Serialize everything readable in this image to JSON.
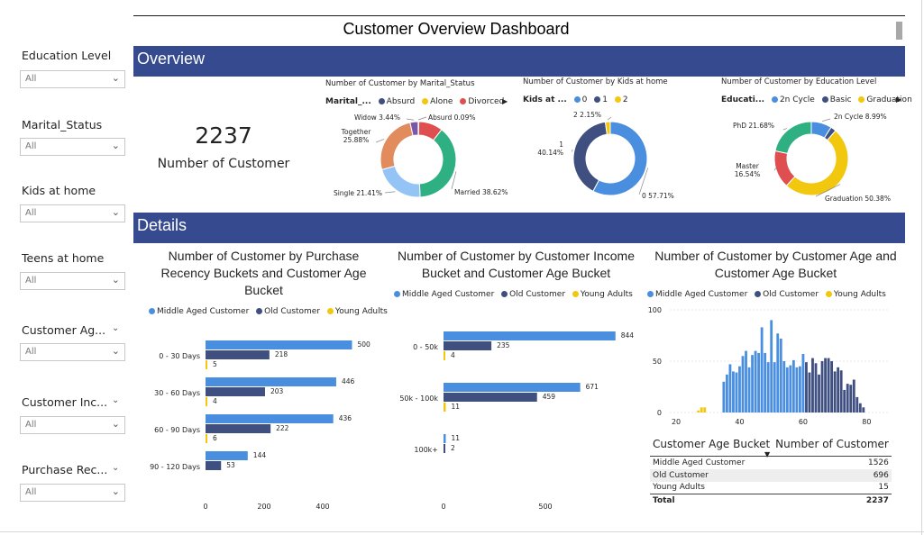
{
  "title": "Customer Overview Dashboard",
  "slicers": [
    {
      "label": "Education Level",
      "value": "All",
      "chevron_on_label": false
    },
    {
      "label": "Marital_Status",
      "value": "All",
      "chevron_on_label": false
    },
    {
      "label": "Kids at home",
      "value": "All",
      "chevron_on_label": false
    },
    {
      "label": "Teens at home",
      "value": "All",
      "chevron_on_label": false
    },
    {
      "label": "Customer Ag...",
      "value": "All",
      "chevron_on_label": true
    },
    {
      "label": "Customer Inc...",
      "value": "All",
      "chevron_on_label": true
    },
    {
      "label": "Purchase Rec...",
      "value": "All",
      "chevron_on_label": true
    }
  ],
  "overview": {
    "banner": "Overview",
    "kpi": {
      "value": "2237",
      "label": "Number of Customer"
    }
  },
  "details": {
    "banner": "Details"
  },
  "colors": {
    "banner": "#354a8f",
    "middle_aged": "#4a8fdf",
    "old": "#3e4f80",
    "young": "#f2c80f",
    "absurd": "#3e4f80",
    "alone": "#f2c80f",
    "divorced": "#e04f50",
    "married": "#2eb083",
    "single": "#94c4f6",
    "together": "#e28b5c",
    "widow": "#7b57a8",
    "kids0": "#4a8fdf",
    "kids1": "#3e4f80",
    "kids2": "#f2c80f",
    "edu_2ncycle": "#4a8fdf",
    "edu_basic": "#3e4f80",
    "edu_graduation": "#f2c80f",
    "edu_master": "#e04f50",
    "edu_phd": "#2eb083"
  },
  "chart_data": [
    {
      "type": "pie",
      "title": "Number of Customer by Marital_Status",
      "legend_title": "Marital_...",
      "legend_items": [
        "Absurd",
        "Alone",
        "Divorced"
      ],
      "slices": [
        {
          "label": "Absurd",
          "percent": 0.09,
          "text": "Absurd 0.09%"
        },
        {
          "label": "Alone",
          "percent": 0.13,
          "text": ""
        },
        {
          "label": "Divorced",
          "percent": 10.37,
          "text": ""
        },
        {
          "label": "Married",
          "percent": 38.62,
          "text": "Married 38.62%"
        },
        {
          "label": "Single",
          "percent": 21.41,
          "text": "Single 21.41%"
        },
        {
          "label": "Together",
          "percent": 25.88,
          "text": "Together 25.88%"
        },
        {
          "label": "Widow",
          "percent": 3.44,
          "text": "Widow 3.44%"
        }
      ]
    },
    {
      "type": "pie",
      "title": "Number of Customer by Kids at home",
      "legend_title": "Kids at ...",
      "legend_items": [
        "0",
        "1",
        "2"
      ],
      "slices": [
        {
          "label": "0",
          "percent": 57.71,
          "text": "0 57.71%"
        },
        {
          "label": "1",
          "percent": 40.14,
          "text": "1 40.14%"
        },
        {
          "label": "2",
          "percent": 2.15,
          "text": "2 2.15%"
        }
      ]
    },
    {
      "type": "pie",
      "title": "Number of Customer by Education Level",
      "legend_title": "Educati...",
      "legend_items": [
        "2n Cycle",
        "Basic",
        "Graduation"
      ],
      "slices": [
        {
          "label": "2n Cycle",
          "percent": 8.99,
          "text": "2n Cycle 8.99%"
        },
        {
          "label": "Basic",
          "percent": 2.41,
          "text": ""
        },
        {
          "label": "Graduation",
          "percent": 50.38,
          "text": "Graduation 50.38%"
        },
        {
          "label": "Master",
          "percent": 16.54,
          "text": "Master 16.54%"
        },
        {
          "label": "PhD",
          "percent": 21.68,
          "text": "PhD 21.68%"
        }
      ]
    },
    {
      "type": "bar",
      "orientation": "horizontal",
      "title": "Number of Customer by Purchase Recency Buckets and Customer Age Bucket",
      "categories": [
        "0 - 30 Days",
        "30 - 60 Days",
        "60 - 90 Days",
        "90 - 120 Days"
      ],
      "series": [
        {
          "name": "Middle Aged Customer",
          "values": [
            500,
            446,
            436,
            144
          ]
        },
        {
          "name": "Old Customer",
          "values": [
            218,
            203,
            222,
            53
          ]
        },
        {
          "name": "Young Adults",
          "values": [
            5,
            4,
            6,
            null
          ]
        }
      ],
      "xticks": [
        "0",
        "200",
        "400"
      ],
      "xlim": [
        0,
        700
      ],
      "grid": false,
      "legend_position": "top"
    },
    {
      "type": "bar",
      "orientation": "horizontal",
      "title": "Number of Customer by Customer Income Bucket and Customer Age Bucket",
      "categories": [
        "0 - 50k",
        "50k - 100k",
        "100k+"
      ],
      "series": [
        {
          "name": "Middle Aged Customer",
          "values": [
            844,
            671,
            11
          ]
        },
        {
          "name": "Old Customer",
          "values": [
            235,
            459,
            2
          ]
        },
        {
          "name": "Young Adults",
          "values": [
            4,
            11,
            null
          ]
        }
      ],
      "xticks": [
        "0",
        "500"
      ],
      "xlim": [
        0,
        900
      ],
      "grid": false,
      "legend_position": "top"
    },
    {
      "type": "bar",
      "orientation": "vertical",
      "title": "Number of Customer by Customer Age and Customer Age Bucket",
      "series": [
        {
          "name": "Middle Aged Customer",
          "x": [
            35,
            36,
            37,
            38,
            39,
            40,
            41,
            42,
            43,
            44,
            45,
            46,
            47,
            48,
            49,
            50,
            51,
            52,
            53,
            54,
            55,
            56,
            57,
            58,
            59,
            60
          ],
          "values": [
            30,
            37,
            47,
            40,
            39,
            45,
            55,
            60,
            44,
            56,
            60,
            58,
            83,
            58,
            49,
            90,
            49,
            77,
            72,
            50,
            44,
            46,
            51,
            44,
            45,
            57
          ]
        },
        {
          "name": "Old Customer",
          "x": [
            61,
            62,
            63,
            64,
            65,
            66,
            67,
            68,
            69,
            70,
            71,
            72,
            73,
            74,
            75,
            76,
            77,
            78,
            79
          ],
          "values": [
            49,
            39,
            53,
            48,
            37,
            50,
            53,
            53,
            50,
            40,
            44,
            41,
            22,
            28,
            27,
            32,
            15,
            9,
            5
          ]
        },
        {
          "name": "Young Adults",
          "x": [
            27,
            28,
            29
          ],
          "values": [
            2,
            5,
            5
          ]
        }
      ],
      "xticks": [
        "20",
        "40",
        "60",
        "80"
      ],
      "yticks": [
        "0",
        "50",
        "100"
      ],
      "xlim": [
        18,
        87
      ],
      "ylim": [
        0,
        100
      ],
      "grid": true,
      "legend_position": "top"
    },
    {
      "type": "table",
      "columns": [
        "Customer Age Bucket",
        "Number of Customer"
      ],
      "rows": [
        [
          "Middle Aged Customer",
          "1526"
        ],
        [
          "Old Customer",
          "696"
        ],
        [
          "Young Adults",
          "15"
        ]
      ],
      "total": [
        "Total",
        "2237"
      ]
    }
  ]
}
